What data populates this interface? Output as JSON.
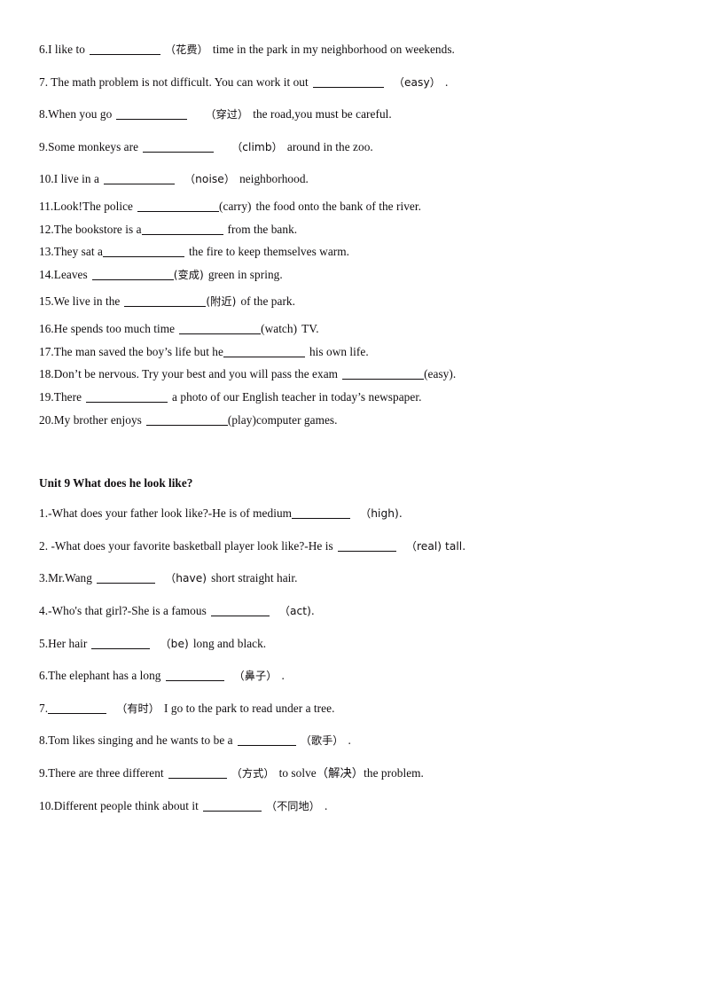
{
  "document": {
    "type": "english-grammar-worksheet",
    "text_color": "#100d0f",
    "background_color": "#ffffff"
  },
  "section_one": {
    "items": [
      {
        "number": "6.",
        "pre": "I like to",
        "hint": "（花费）",
        "post": "time in the park in my neighborhood on weekends."
      },
      {
        "number": "7.",
        "pre": " The math problem is not difficult. You can work it out",
        "hint": "（easy）",
        "post": "."
      },
      {
        "number": "8.",
        "pre": "When you go",
        "hint": "（穿过）",
        "post": "the road,you must be careful."
      },
      {
        "number": "9.",
        "pre": "Some monkeys are",
        "hint": "（climb）",
        "post": "around in the zoo."
      },
      {
        "number": "10.",
        "pre": "I live in a",
        "hint": "（noise）",
        "post": "neighborhood."
      },
      {
        "number": "11.",
        "pre": "Look!The police",
        "hint": "(carry)",
        "post": "the food onto the bank of the river."
      },
      {
        "number": "12.",
        "pre": "The bookstore is a",
        "hint": "",
        "post": "from the bank."
      },
      {
        "number": "13.",
        "pre": "They sat a",
        "hint": "",
        "post": "the fire to keep themselves warm."
      },
      {
        "number": "14.",
        "pre": "Leaves",
        "hint": "(变成)",
        "post": "green in spring."
      },
      {
        "number": "15.",
        "pre": "We live in the",
        "hint": "(附近)",
        "post": "of the park."
      },
      {
        "number": "16.",
        "pre": "He spends too much time",
        "hint": "(watch)",
        "post": "TV."
      },
      {
        "number": "17.",
        "pre": "The man saved the boy’s life but he",
        "hint": "",
        "post": "his own life."
      },
      {
        "number": "18.",
        "pre": "Don’t be nervous. Try your best and you will pass the exam",
        "hint": "(easy)",
        "post": "."
      },
      {
        "number": "19.",
        "pre": "There",
        "hint": "",
        "post": "a photo of our English teacher in today’s newspaper."
      },
      {
        "number": "20.",
        "pre": "My brother enjoys",
        "hint": "(play)",
        "post": "computer games."
      }
    ]
  },
  "unit_nine": {
    "heading": "Unit 9 What does he look like?",
    "items": [
      {
        "number": "1.",
        "pre": "-What does your father look like?-He is of medium",
        "hint": "（high).",
        "post": ""
      },
      {
        "number": "2.",
        "pre": " -What does your favorite basketball player look like?-He is",
        "hint": "（real) tall.",
        "post": ""
      },
      {
        "number": "3.",
        "pre": "Mr.Wang",
        "hint": "（have)",
        "post": "short straight hair."
      },
      {
        "number": "4.",
        "pre": "-Who's that girl?-She is a famous",
        "hint": "（act).",
        "post": ""
      },
      {
        "number": "5.",
        "pre": "Her hair",
        "hint": "（be)",
        "post": "long and black."
      },
      {
        "number": "6.",
        "pre": "The elephant has a long",
        "hint": "（鼻子）",
        "post": "."
      },
      {
        "number": "7.",
        "pre": "",
        "hint": "（有时）",
        "post": "I go to the park to read under a tree."
      },
      {
        "number": "8.",
        "pre": "Tom likes singing and he wants to be a",
        "hint": "（歌手）",
        "post": "."
      },
      {
        "number": "9.",
        "pre": "There are three different",
        "hint": "（方式）",
        "post": "to solve（解决）the problem."
      },
      {
        "number": "10.",
        "pre": "Different people think about it",
        "hint": "（不同地）",
        "post": "."
      }
    ]
  }
}
